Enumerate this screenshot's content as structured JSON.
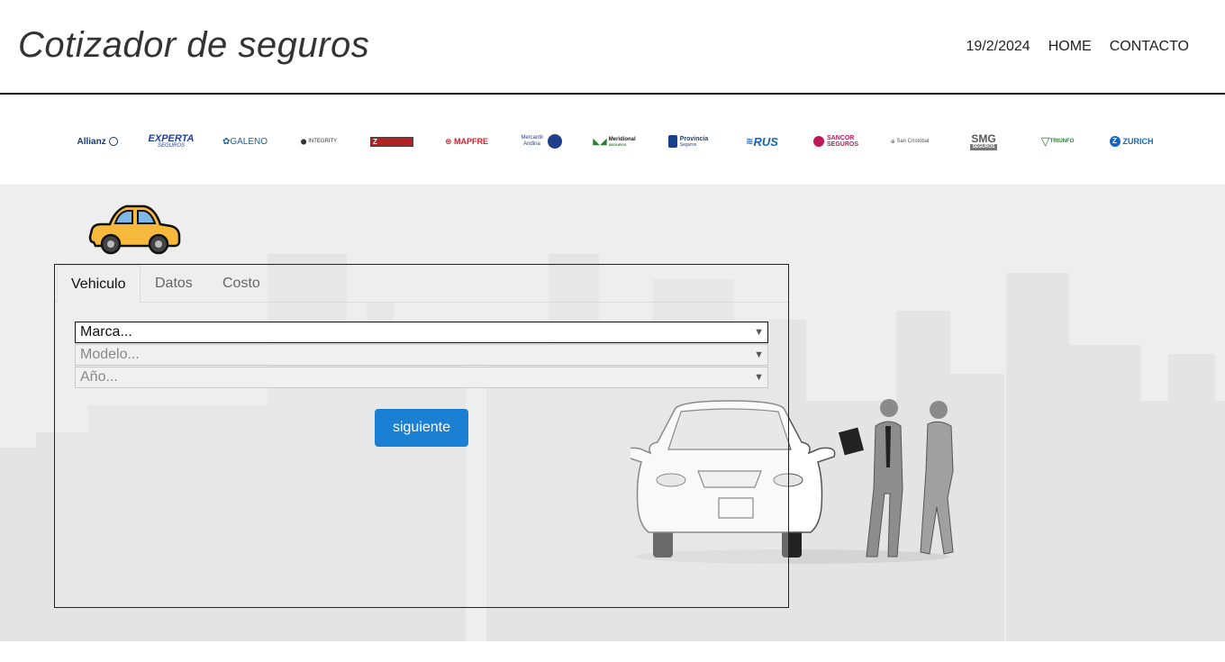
{
  "header": {
    "title": "Cotizador de seguros",
    "date": "19/2/2024",
    "nav": [
      "HOME",
      "CONTACTO"
    ]
  },
  "insurers": [
    {
      "name": "Allianz",
      "color": "#123a7a"
    },
    {
      "name": "EXPERTA",
      "sub": "SEGUROS",
      "color": "#1f3f9a"
    },
    {
      "name": "GALENO",
      "color": "#1b5f8c"
    },
    {
      "name": "INTEGRITY",
      "color": "#333333"
    },
    {
      "name": "Z",
      "color": "#b22222"
    },
    {
      "name": "MAPFRE",
      "color": "#d0202a"
    },
    {
      "name": "Mercantil Andina",
      "color": "#1f3f8a"
    },
    {
      "name": "Meridional",
      "sub": "SEGUROS",
      "color": "#2e7d32"
    },
    {
      "name": "Provincia",
      "sub": "Seguros",
      "color": "#1a3f8a"
    },
    {
      "name": "RUS",
      "color": "#1565c0"
    },
    {
      "name": "SANCOR",
      "sub": "SEGUROS",
      "color": "#c2185b"
    },
    {
      "name": "San Cristóbal",
      "color": "#555555"
    },
    {
      "name": "SMG",
      "sub": "SEGUROS",
      "color": "#c62828"
    },
    {
      "name": "TRIUNFO",
      "color": "#2e7d32"
    },
    {
      "name": "ZURICH",
      "color": "#1565c0"
    }
  ],
  "form": {
    "tabs": [
      "Vehiculo",
      "Datos",
      "Costo"
    ],
    "active_tab": "Vehiculo",
    "brand_select": "Marca...",
    "model_select": "Modelo...",
    "year_select": "Año...",
    "next_button": "siguiente"
  },
  "colors": {
    "primary": "#1b7fd4",
    "band": "#eeeeee",
    "car_icon": "#f6b93b"
  }
}
